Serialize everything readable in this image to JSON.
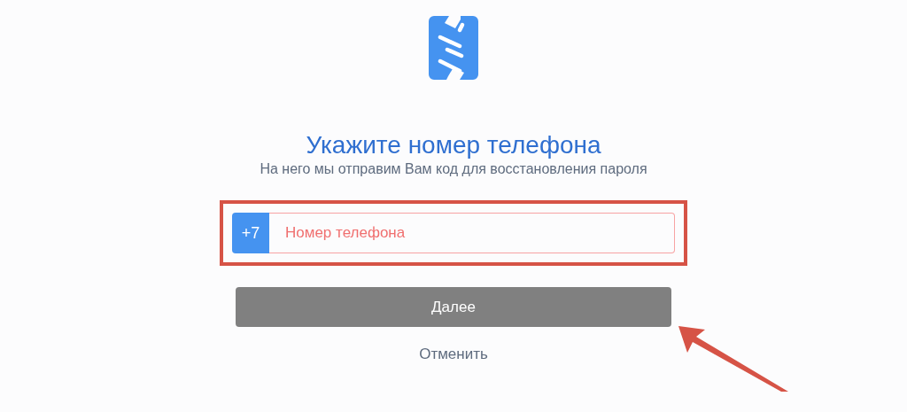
{
  "heading": "Укажите номер телефона",
  "subheading": "На него мы отправим Вам код для восстановления пароля",
  "phone_field": {
    "prefix": "+7",
    "placeholder": "Номер телефона",
    "invalid": true
  },
  "next_button": {
    "label": "Далее",
    "disabled": true
  },
  "cancel_link": "Отменить"
}
